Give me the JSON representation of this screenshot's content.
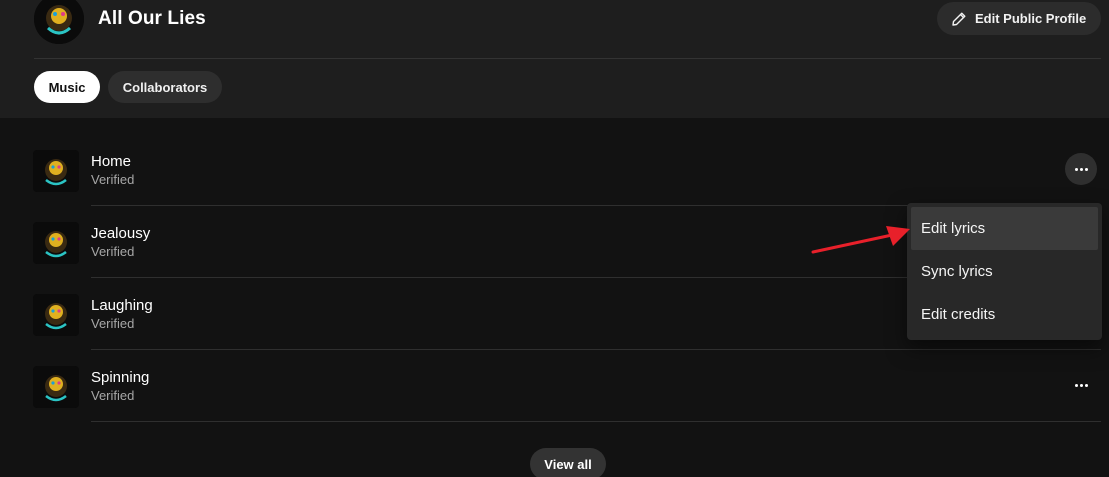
{
  "artist": {
    "name": "All Our Lies",
    "avatar_icon": "artist-artwork"
  },
  "header": {
    "edit_profile_label": "Edit Public Profile",
    "edit_icon": "pencil-icon"
  },
  "tabs": [
    {
      "label": "Music",
      "selected": true
    },
    {
      "label": "Collaborators",
      "selected": false
    }
  ],
  "tracks": [
    {
      "title": "Home",
      "status": "Verified"
    },
    {
      "title": "Jealousy",
      "status": "Verified"
    },
    {
      "title": "Laughing",
      "status": "Verified"
    },
    {
      "title": "Spinning",
      "status": "Verified"
    }
  ],
  "context_menu": {
    "items": [
      {
        "label": "Edit lyrics",
        "highlighted": true
      },
      {
        "label": "Sync lyrics",
        "highlighted": false
      },
      {
        "label": "Edit credits",
        "highlighted": false
      }
    ]
  },
  "footer": {
    "view_all_label": "View all"
  },
  "colors": {
    "background": "#121212",
    "header_bg": "#1e1e1e",
    "menu_bg": "#282828",
    "annotation_arrow": "#e8202a",
    "secondary_text": "#a7a7a7"
  }
}
